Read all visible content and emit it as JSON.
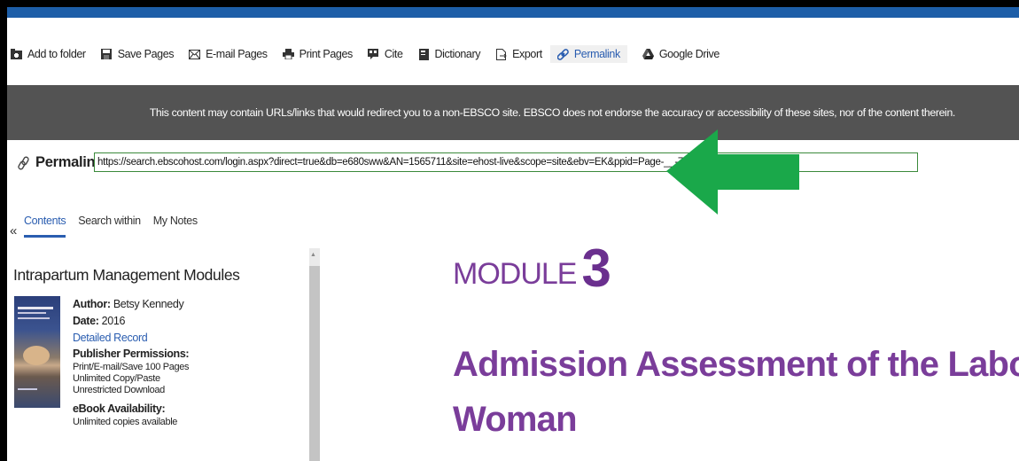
{
  "toolbar": {
    "items": [
      {
        "label": "Add to folder",
        "icon": "folder-icon"
      },
      {
        "label": "Save Pages",
        "icon": "save-icon"
      },
      {
        "label": "E-mail Pages",
        "icon": "email-icon"
      },
      {
        "label": "Print Pages",
        "icon": "print-icon"
      },
      {
        "label": "Cite",
        "icon": "cite-icon"
      },
      {
        "label": "Dictionary",
        "icon": "dictionary-icon"
      },
      {
        "label": "Export",
        "icon": "export-icon"
      },
      {
        "label": "Permalink",
        "icon": "link-icon"
      },
      {
        "label": "Google Drive",
        "icon": "google-drive-icon"
      }
    ]
  },
  "notice": "This content may contain URLs/links that would redirect you to a non-EBSCO site. EBSCO does not endorse the accuracy or accessibility of these sites, nor of the content therein.",
  "permalink": {
    "label": "Permalink",
    "url": "https://search.ebscohost.com/login.aspx?direct=true&db=e680sww&AN=1565711&site=ehost-live&scope=site&ebv=EK&ppid=Page-__-71"
  },
  "sidebar": {
    "collapse_label": "«",
    "tabs": [
      "Contents",
      "Search within",
      "My Notes"
    ],
    "book_title": "Intrapartum Management Modules",
    "author_label": "Author:",
    "author": "Betsy Kennedy",
    "date_label": "Date:",
    "date": "2016",
    "detailed_record": "Detailed Record",
    "publisher_label": "Publisher Permissions:",
    "permissions": [
      "Print/E-mail/Save 100 Pages",
      "Unlimited Copy/Paste",
      "Unrestricted Download"
    ],
    "availability_label": "eBook Availability:",
    "availability": "Unlimited copies available"
  },
  "main": {
    "module_label": "MODULE",
    "module_number": "3",
    "chapter_title_line1": "Admission Assessment of the Laboring",
    "chapter_title_line2": "Woman"
  },
  "colors": {
    "brand_blue": "#1d5ea8",
    "notice_bg": "#535353",
    "link": "#2a5db0",
    "accent_purple": "#7a3d9a",
    "arrow_green": "#1aa84a"
  }
}
